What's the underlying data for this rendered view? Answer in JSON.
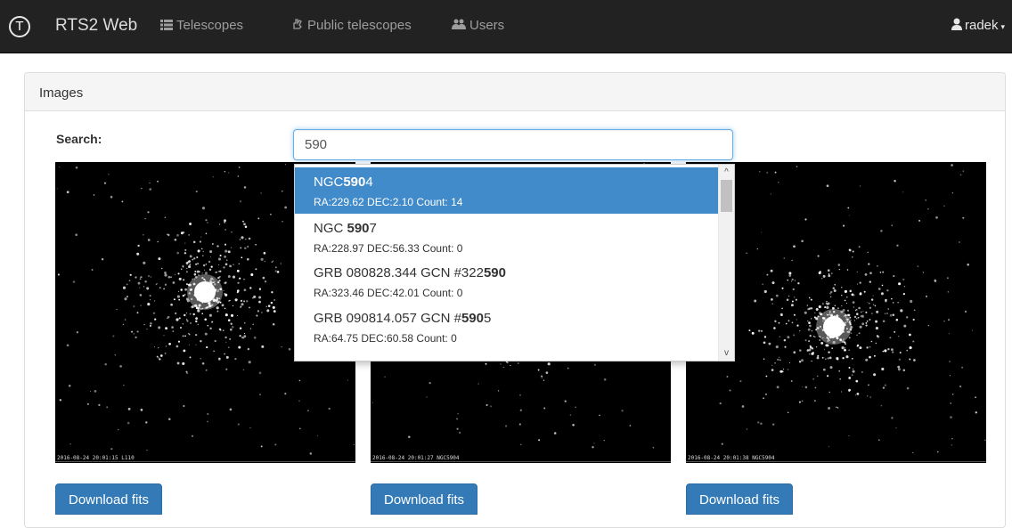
{
  "navbar": {
    "logo_letter": "T",
    "brand": "RTS2 Web",
    "items": [
      {
        "label": "Telescopes",
        "icon": "list-icon"
      },
      {
        "label": "Public telescopes",
        "icon": "hand-icon"
      },
      {
        "label": "Users",
        "icon": "users-icon"
      }
    ],
    "user": {
      "label": "radek",
      "icon": "user-icon"
    }
  },
  "panel": {
    "title": "Images"
  },
  "search": {
    "label": "Search:",
    "value": "590"
  },
  "autocomplete": {
    "items": [
      {
        "name_pre": "NGC",
        "name_match": "590",
        "name_post": "4",
        "info": "RA:229.62 DEC:2.10 Count: 14",
        "active": true
      },
      {
        "name_pre": "NGC ",
        "name_match": "590",
        "name_post": "7",
        "info": "RA:228.97 DEC:56.33 Count: 0",
        "active": false
      },
      {
        "name_pre": "GRB 080828.344 GCN #322",
        "name_match": "590",
        "name_post": "",
        "info": "RA:323.46 DEC:42.01 Count: 0",
        "active": false
      },
      {
        "name_pre": "GRB 090814.057 GCN #",
        "name_match": "590",
        "name_post": "5",
        "info": "RA:64.75 DEC:60.58 Count: 0",
        "active": false
      }
    ]
  },
  "images": [
    {
      "caption": "2016-08-24 20:01:15 L110",
      "download_label": "Download fits"
    },
    {
      "caption": "2016-08-24 20:01:27 NGC5904",
      "download_label": "Download fits"
    },
    {
      "caption": "2016-08-24 20:01:38 NGC5904",
      "download_label": "Download fits"
    }
  ],
  "colors": {
    "navbar": "#222222",
    "accent": "#337ab7",
    "active_item": "#428bca"
  }
}
